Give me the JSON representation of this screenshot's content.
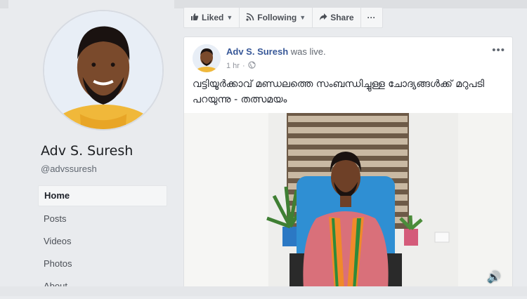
{
  "profile": {
    "name": "Adv S. Suresh",
    "handle": "@advssuresh"
  },
  "nav": {
    "items": [
      {
        "label": "Home",
        "active": true
      },
      {
        "label": "Posts"
      },
      {
        "label": "Videos"
      },
      {
        "label": "Photos"
      },
      {
        "label": "About"
      }
    ]
  },
  "actions": {
    "liked": "Liked",
    "following": "Following",
    "share": "Share",
    "more": "···"
  },
  "post": {
    "author": "Adv S. Suresh",
    "status": " was live.",
    "time": "1 hr",
    "text": "വട്ടിയൂർക്കാവ് മണ്ഡലത്തെ സംബന്ധിച്ചുള്ള ചോദ്യങ്ങൾക്ക് മറുപടി പറയുന്നു - തത്സമയം",
    "more": "•••"
  },
  "icons": {
    "like": "thumbs-up-icon",
    "following": "rss-icon",
    "share": "share-arrow-icon",
    "privacy": "globe-icon",
    "volume": "volume-icon"
  },
  "colors": {
    "link": "#385898",
    "bg": "#e9ebee",
    "card": "#ffffff"
  }
}
